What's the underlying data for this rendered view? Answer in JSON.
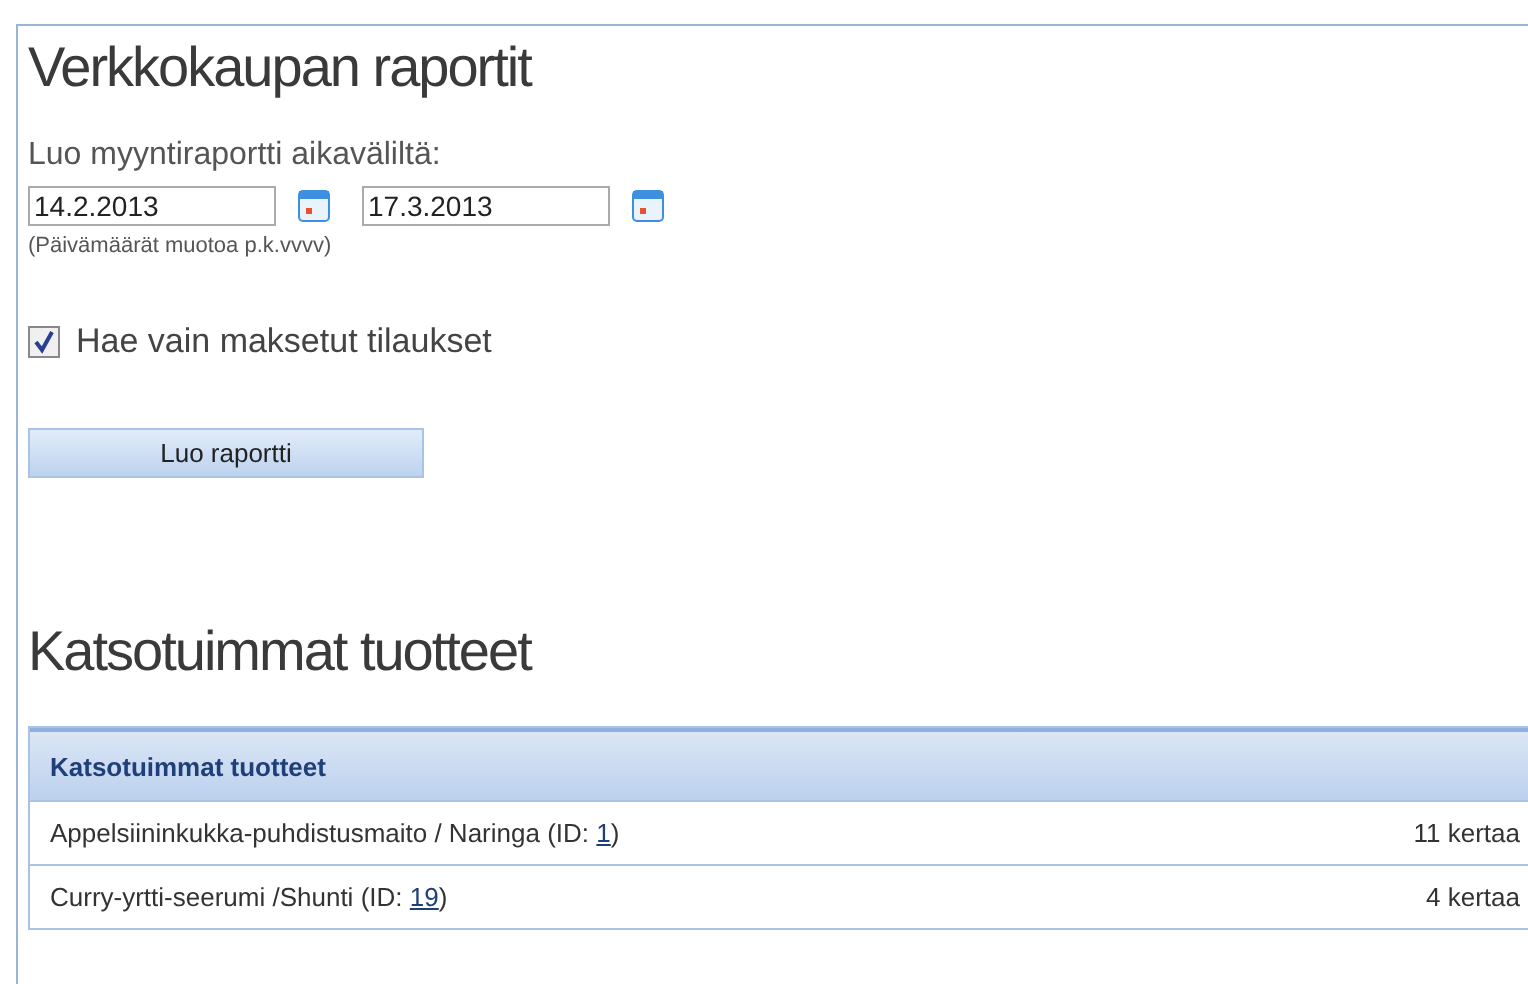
{
  "title": "Verkkokaupan raportit",
  "report_form": {
    "label": "Luo myyntiraportti aikaväliltä:",
    "start_date": "14.2.2013",
    "end_date": "17.3.2013",
    "hint": "(Päivämäärät muotoa p.k.vvvv)",
    "paid_only": {
      "label": "Hae vain maksetut tilaukset",
      "checked": true
    },
    "button": "Luo raportti"
  },
  "section_title": "Katsotuimmat tuotteet",
  "table": {
    "header": "Katsotuimmat tuotteet",
    "rows": [
      {
        "product": "Appelsiininkukka-puhdistusmaito / Naringa",
        "id_prefix": "(ID:",
        "id": "1",
        "id_suffix": ")",
        "views": "11 kertaa"
      },
      {
        "product": "Curry-yrtti-seerumi /Shunti",
        "id_prefix": "(ID:",
        "id": "19",
        "id_suffix": ")",
        "views": "4 kertaa"
      }
    ]
  }
}
